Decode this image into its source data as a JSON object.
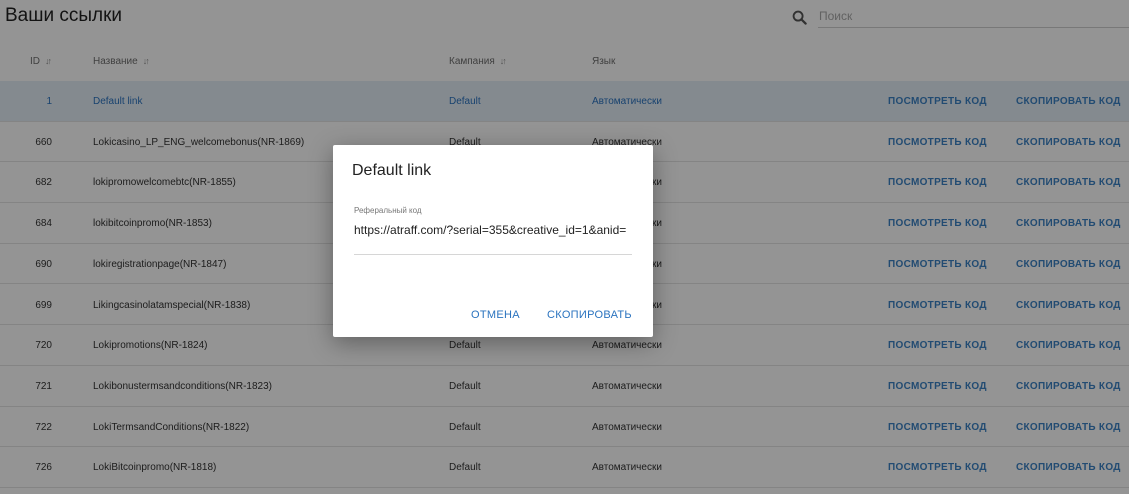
{
  "page": {
    "title": "Ваши ссылки"
  },
  "search": {
    "placeholder": "Поиск",
    "icon": "search-icon"
  },
  "table": {
    "headers": {
      "id": "ID",
      "name": "Название",
      "campaign": "Кампания",
      "language": "Язык"
    },
    "actions": {
      "view": "ПОСМОТРЕТЬ КОД",
      "copy": "СКОПИРОВАТЬ КОД"
    },
    "rows": [
      {
        "id": "1",
        "name": "Default link",
        "campaign": "Default",
        "language": "Автоматически",
        "selected": true
      },
      {
        "id": "660",
        "name": "Lokicasino_LP_ENG_welcomebonus(NR-1869)",
        "campaign": "Default",
        "language": "Автоматически"
      },
      {
        "id": "682",
        "name": "lokipromowelcomebtc(NR-1855)",
        "campaign": "Default",
        "language": "Автоматически"
      },
      {
        "id": "684",
        "name": "lokibitcoinpromo(NR-1853)",
        "campaign": "Default",
        "language": "Автоматически"
      },
      {
        "id": "690",
        "name": "lokiregistrationpage(NR-1847)",
        "campaign": "Default",
        "language": "Автоматически"
      },
      {
        "id": "699",
        "name": "Likingcasinolatamspecial(NR-1838)",
        "campaign": "Default",
        "language": "Автоматически"
      },
      {
        "id": "720",
        "name": "Lokipromotions(NR-1824)",
        "campaign": "Default",
        "language": "Автоматически"
      },
      {
        "id": "721",
        "name": "Lokibonustermsandconditions(NR-1823)",
        "campaign": "Default",
        "language": "Автоматически"
      },
      {
        "id": "722",
        "name": "LokiTermsandConditions(NR-1822)",
        "campaign": "Default",
        "language": "Автоматически"
      },
      {
        "id": "726",
        "name": "LokiBitcoinpromo(NR-1818)",
        "campaign": "Default",
        "language": "Автоматически"
      }
    ]
  },
  "dialog": {
    "title": "Default link",
    "field_label": "Реферальный код",
    "field_value": "https://atraff.com/?serial=355&creative_id=1&anid=",
    "cancel_label": "ОТМЕНА",
    "copy_label": "СКОПИРОВАТЬ"
  },
  "colors": {
    "accent": "#2a73bf",
    "selected_row": "#e4eef7",
    "overlay": "rgba(0,0,0,0.42)"
  }
}
